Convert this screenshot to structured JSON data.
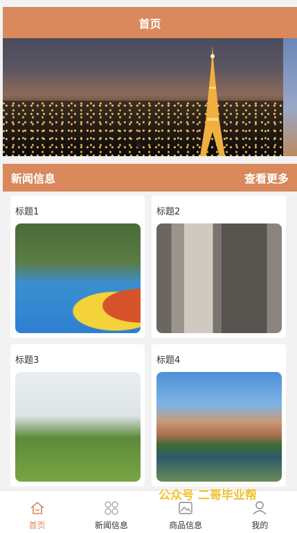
{
  "header": {
    "title": "首页"
  },
  "news_section": {
    "title": "新闻信息",
    "more_label": "查看更多"
  },
  "cards": [
    {
      "title": "标题1"
    },
    {
      "title": "标题2"
    },
    {
      "title": "标题3"
    },
    {
      "title": "标题4"
    }
  ],
  "tabbar": [
    {
      "label": "首页",
      "icon": "home-icon",
      "active": true
    },
    {
      "label": "新闻信息",
      "icon": "grid-icon",
      "active": false
    },
    {
      "label": "商品信息",
      "icon": "picture-icon",
      "active": false
    },
    {
      "label": "我的",
      "icon": "user-icon",
      "active": false
    }
  ],
  "watermark": "公众号 二哥毕业帮",
  "colors": {
    "accent": "#d9895c",
    "background": "#f2f2f2"
  }
}
